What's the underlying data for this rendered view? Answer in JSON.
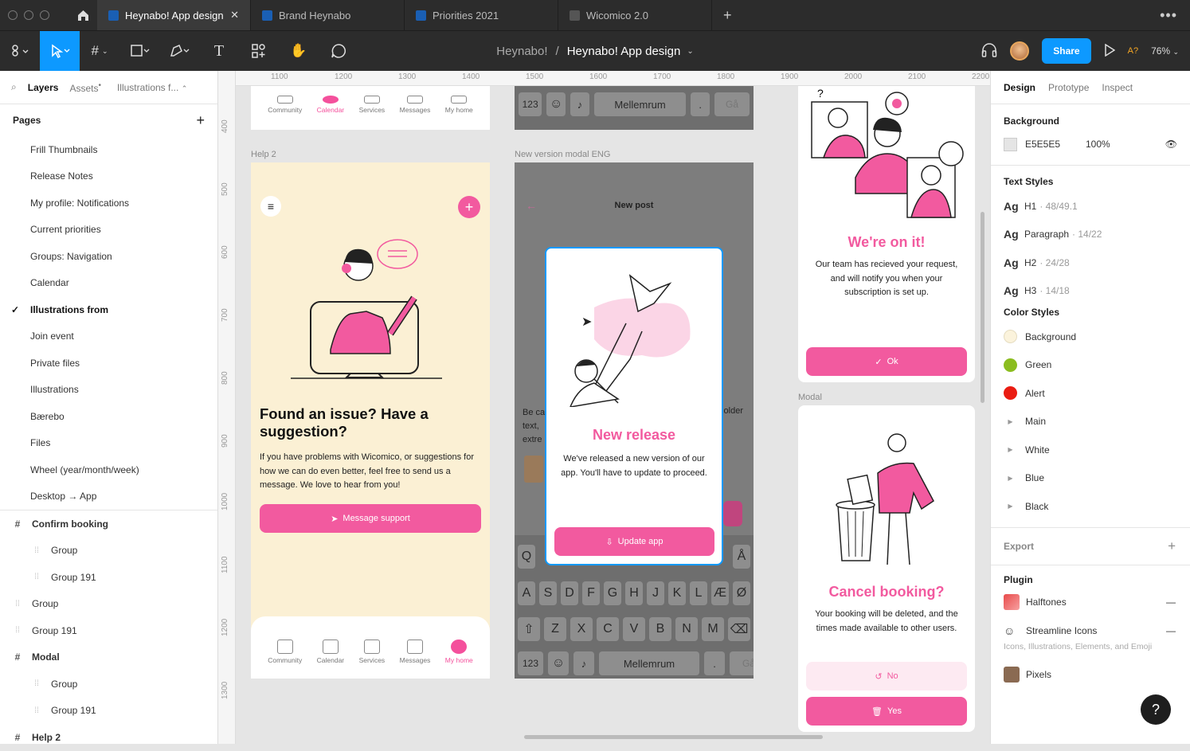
{
  "tabs": [
    {
      "label": "Heynabo! App design",
      "active": true
    },
    {
      "label": "Brand Heynabo",
      "active": false
    },
    {
      "label": "Priorities 2021",
      "active": false
    },
    {
      "label": "Wicomico 2.0",
      "active": false
    }
  ],
  "toolbar": {
    "project": "Heynabo!",
    "separator": "/",
    "file": "Heynabo! App design",
    "share": "Share",
    "ai": "A?",
    "zoom": "76%"
  },
  "left": {
    "tab_layers": "Layers",
    "tab_assets": "Assets",
    "tab_page": "Illustrations f...",
    "pages_title": "Pages",
    "pages": [
      "Frill Thumbnails",
      "Release Notes",
      "My profile: Notifications",
      "Current priorities",
      "Groups: Navigation",
      "Calendar",
      "Illustrations from",
      "Join event",
      "Private files",
      "Illustrations",
      "Bærebo",
      "Files",
      "Wheel (year/month/week)",
      "Desktop → App"
    ],
    "layers": [
      {
        "label": "Confirm booking",
        "type": "frame",
        "indent": 0
      },
      {
        "label": "Group",
        "type": "group",
        "indent": 1
      },
      {
        "label": "Group 191",
        "type": "group",
        "indent": 1
      },
      {
        "label": "Group",
        "type": "group",
        "indent": 0
      },
      {
        "label": "Group 191",
        "type": "group",
        "indent": 0
      },
      {
        "label": "Modal",
        "type": "frame",
        "indent": 0
      },
      {
        "label": "Group",
        "type": "group",
        "indent": 1
      },
      {
        "label": "Group 191",
        "type": "group",
        "indent": 1
      },
      {
        "label": "Help 2",
        "type": "frame",
        "indent": 0
      }
    ]
  },
  "rulers": {
    "h": [
      "1100",
      "1200",
      "1300",
      "1400",
      "1500",
      "1600",
      "1700",
      "1800",
      "1900",
      "2000",
      "2100",
      "2200"
    ],
    "v": [
      "400",
      "500",
      "600",
      "700",
      "800",
      "900",
      "1000",
      "1100",
      "1200",
      "1300"
    ]
  },
  "canvas": {
    "nav": [
      "Community",
      "Calendar",
      "Services",
      "Messages",
      "My home"
    ],
    "help2": {
      "label": "Help 2",
      "title": "Found an issue? Have a suggestion?",
      "body": "If you have problems with Wicomico, or suggestions for how we can do even better, feel free to send us a message. We love to hear from you!",
      "button": "Message support"
    },
    "modal_eng": {
      "label": "New version modal ENG",
      "header": "New post",
      "title": "New release",
      "body": "We've released a new version of our app. You'll have to update to proceed.",
      "button": "Update app",
      "bg_text1": "Be ca",
      "bg_text2": "text,",
      "bg_text3": "extre",
      "bg_text4": "older",
      "space": "Mellemrum",
      "num": "123",
      "go": "Gå",
      "dot": "."
    },
    "onit": {
      "title": "We're on it!",
      "body": "Our team has recieved your request, and will notify you when your subscription is set up.",
      "button": "Ok"
    },
    "modal": {
      "label": "Modal",
      "title": "Cancel booking?",
      "body": "Your booking will be deleted, and the times made available to other users.",
      "no": "No",
      "yes": "Yes"
    }
  },
  "right": {
    "tab_design": "Design",
    "tab_prototype": "Prototype",
    "tab_inspect": "Inspect",
    "background_title": "Background",
    "bg_hex": "E5E5E5",
    "bg_opacity": "100%",
    "text_styles_title": "Text Styles",
    "text_styles": [
      {
        "name": "H1",
        "meta": "· 48/49.1"
      },
      {
        "name": "Paragraph",
        "meta": "· 14/22"
      },
      {
        "name": "H2",
        "meta": "· 24/28"
      },
      {
        "name": "H3",
        "meta": "· 14/18"
      }
    ],
    "color_styles_title": "Color Styles",
    "color_styles": [
      {
        "name": "Background",
        "color": "#fbf3dc",
        "group": false
      },
      {
        "name": "Green",
        "color": "#8bbd1f",
        "group": false
      },
      {
        "name": "Alert",
        "color": "#ea1c12",
        "group": false
      },
      {
        "name": "Main",
        "color": "",
        "group": true
      },
      {
        "name": "White",
        "color": "",
        "group": true
      },
      {
        "name": "Blue",
        "color": "",
        "group": true
      },
      {
        "name": "Black",
        "color": "",
        "group": true
      }
    ],
    "export": "Export",
    "plugin_title": "Plugin",
    "plugins": [
      "Halftones",
      "Streamline Icons"
    ],
    "plugin_desc": "Icons, Illustrations, Elements, and Emoji",
    "pixels": "Pixels"
  },
  "colors": {
    "accent": "#0d99ff",
    "pink": "#f25a9f",
    "cream": "#fbf0d4"
  }
}
